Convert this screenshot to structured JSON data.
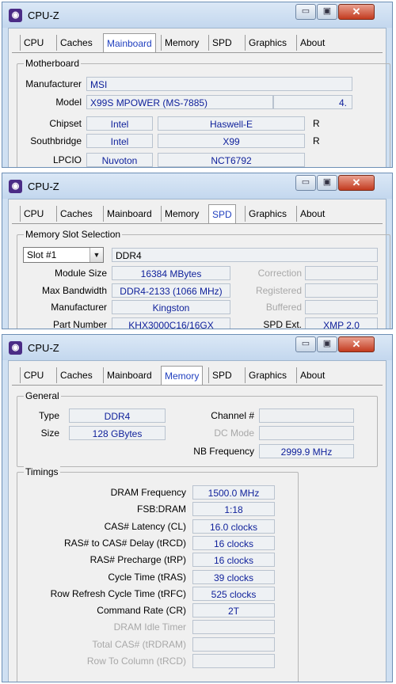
{
  "app_title": "CPU-Z",
  "app_icon": "cpu-z-icon",
  "window_buttons": {
    "minimize": "▭",
    "maximize": "▣",
    "close": "✕"
  },
  "tabs": [
    "CPU",
    "Caches",
    "Mainboard",
    "Memory",
    "SPD",
    "Graphics",
    "About"
  ],
  "mainboard": {
    "active_tab": "Mainboard",
    "group": "Motherboard",
    "manufacturer_label": "Manufacturer",
    "manufacturer": "MSI",
    "model_label": "Model",
    "model": "X99S MPOWER (MS-7885)",
    "model_rev": "4.",
    "chipset_label": "Chipset",
    "chipset_vendor": "Intel",
    "chipset_model": "Haswell-E",
    "chipset_rev_label": "R",
    "southbridge_label": "Southbridge",
    "southbridge_vendor": "Intel",
    "southbridge_model": "X99",
    "southbridge_rev_label": "R",
    "lpcio_label": "LPCIO",
    "lpcio_vendor": "Nuvoton",
    "lpcio_model": "NCT6792"
  },
  "spd": {
    "active_tab": "SPD",
    "group": "Memory Slot Selection",
    "slot": "Slot #1",
    "type": "DDR4",
    "module_size_label": "Module Size",
    "module_size": "16384 MBytes",
    "max_bandwidth_label": "Max Bandwidth",
    "max_bandwidth": "DDR4-2133 (1066 MHz)",
    "manufacturer_label": "Manufacturer",
    "manufacturer": "Kingston",
    "part_number_label": "Part Number",
    "part_number": "KHX3000C16/16GX",
    "correction_label": "Correction",
    "registered_label": "Registered",
    "buffered_label": "Buffered",
    "spd_ext_label": "SPD Ext.",
    "spd_ext": "XMP 2.0"
  },
  "memory": {
    "active_tab": "Memory",
    "general_group": "General",
    "type_label": "Type",
    "type": "DDR4",
    "size_label": "Size",
    "size": "128 GBytes",
    "channel_label": "Channel #",
    "dc_mode_label": "DC Mode",
    "nb_freq_label": "NB Frequency",
    "nb_freq": "2999.9 MHz",
    "timings_group": "Timings",
    "timings": [
      {
        "label": "DRAM Frequency",
        "value": "1500.0 MHz",
        "disabled": false
      },
      {
        "label": "FSB:DRAM",
        "value": "1:18",
        "disabled": false
      },
      {
        "label": "CAS# Latency (CL)",
        "value": "16.0 clocks",
        "disabled": false
      },
      {
        "label": "RAS# to CAS# Delay (tRCD)",
        "value": "16 clocks",
        "disabled": false
      },
      {
        "label": "RAS# Precharge (tRP)",
        "value": "16 clocks",
        "disabled": false
      },
      {
        "label": "Cycle Time (tRAS)",
        "value": "39 clocks",
        "disabled": false
      },
      {
        "label": "Row Refresh Cycle Time (tRFC)",
        "value": "525 clocks",
        "disabled": false
      },
      {
        "label": "Command Rate (CR)",
        "value": "2T",
        "disabled": false
      },
      {
        "label": "DRAM Idle Timer",
        "value": "",
        "disabled": true
      },
      {
        "label": "Total CAS# (tRDRAM)",
        "value": "",
        "disabled": true
      },
      {
        "label": "Row To Column (tRCD)",
        "value": "",
        "disabled": true
      }
    ]
  }
}
